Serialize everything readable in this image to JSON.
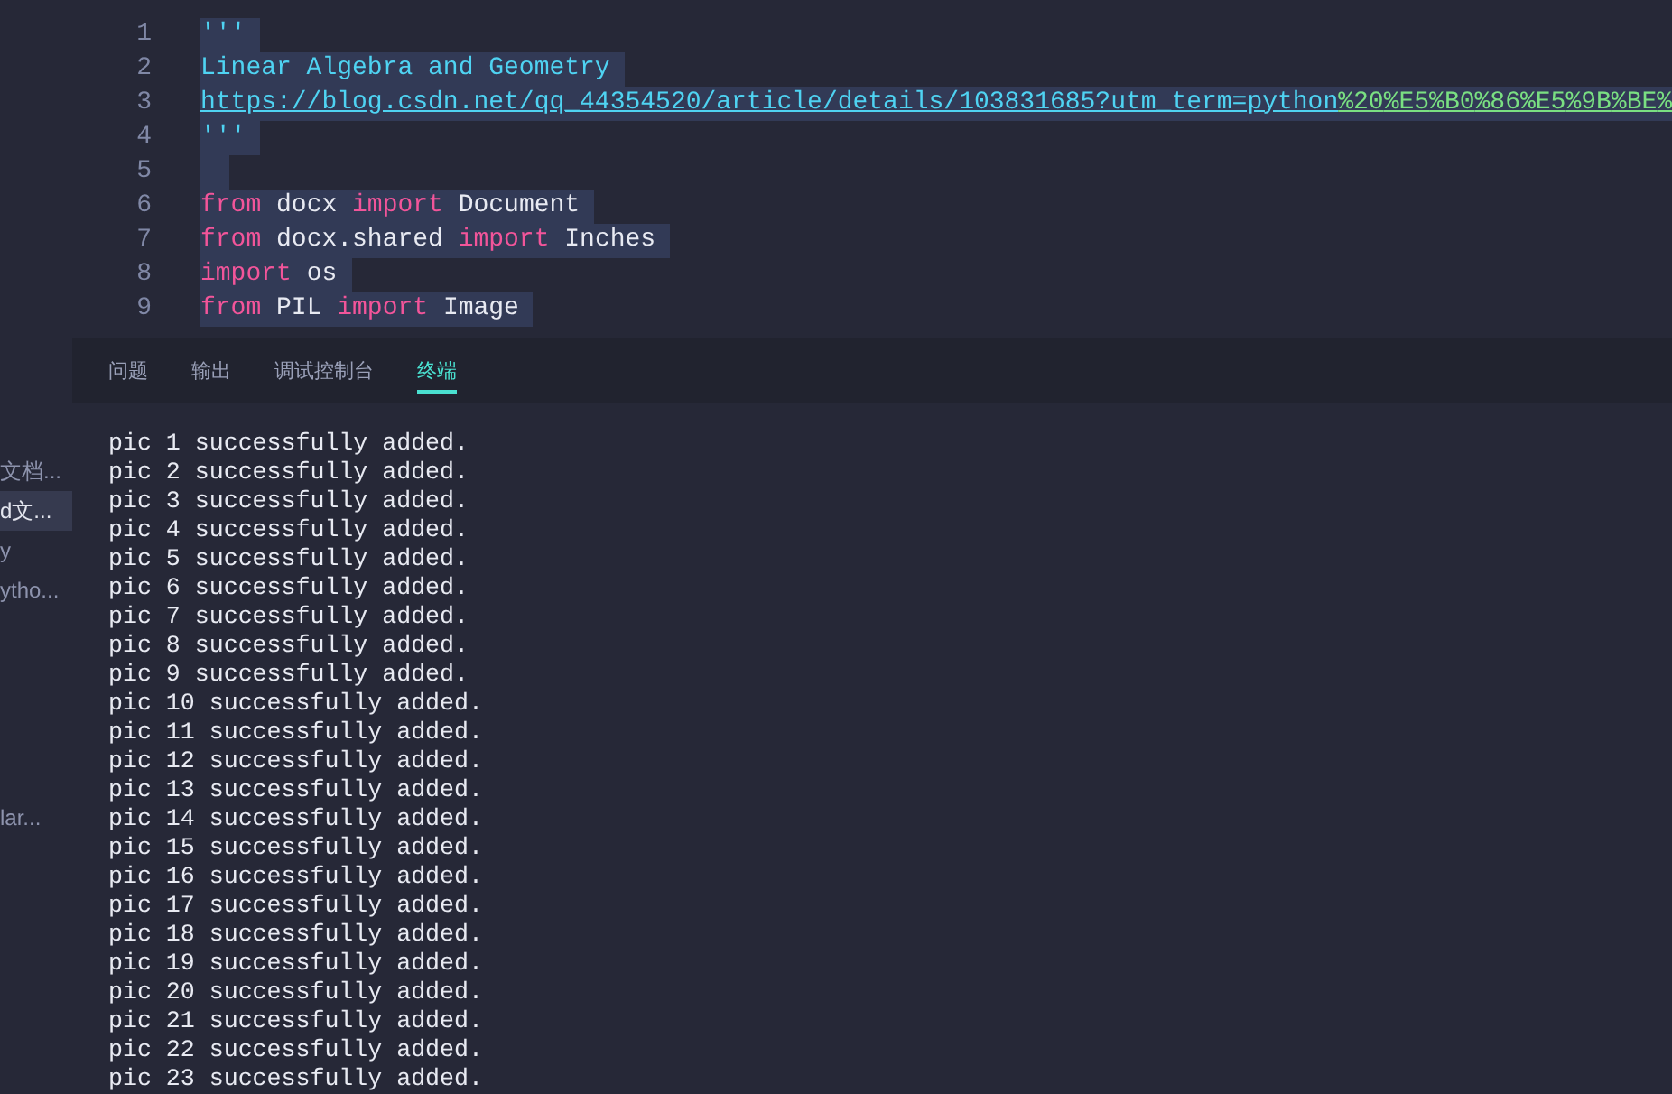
{
  "sidebar": {
    "items": [
      {
        "label": "文档...",
        "selected": false
      },
      {
        "label": "d文...",
        "selected": true
      },
      {
        "label": "y",
        "selected": false
      },
      {
        "label": "ytho...",
        "selected": false
      },
      {
        "label": "lar...",
        "selected": false
      }
    ]
  },
  "editor": {
    "lines": [
      {
        "number": "1",
        "tokens": [
          {
            "kind": "string",
            "text": "'''"
          }
        ]
      },
      {
        "number": "2",
        "tokens": [
          {
            "kind": "string",
            "text": "Linear Algebra and Geometry"
          }
        ]
      },
      {
        "number": "3",
        "tokens": [
          {
            "kind": "link",
            "text": "https://blog.csdn.net/qq_44354520/article/details/103831685?utm_term=python"
          },
          {
            "kind": "escape",
            "text": "%20"
          },
          {
            "kind": "escape",
            "text": "%E5"
          },
          {
            "kind": "escape",
            "text": "%B0"
          },
          {
            "kind": "escape",
            "text": "%86"
          },
          {
            "kind": "escape",
            "text": "%E5"
          },
          {
            "kind": "escape",
            "text": "%9B"
          },
          {
            "kind": "escape",
            "text": "%BE"
          },
          {
            "kind": "escape",
            "text": "%"
          }
        ]
      },
      {
        "number": "4",
        "tokens": [
          {
            "kind": "string",
            "text": "'''"
          }
        ]
      },
      {
        "number": "5"
      },
      {
        "number": "6",
        "tokens": [
          {
            "kind": "keyword",
            "text": "from"
          },
          {
            "kind": "plain",
            "text": " docx "
          },
          {
            "kind": "keyword",
            "text": "import"
          },
          {
            "kind": "plain",
            "text": " Document"
          }
        ]
      },
      {
        "number": "7",
        "tokens": [
          {
            "kind": "keyword",
            "text": "from"
          },
          {
            "kind": "plain",
            "text": " docx.shared "
          },
          {
            "kind": "keyword",
            "text": "import"
          },
          {
            "kind": "plain",
            "text": " Inches"
          }
        ]
      },
      {
        "number": "8",
        "tokens": [
          {
            "kind": "keyword",
            "text": "import"
          },
          {
            "kind": "plain",
            "text": " os"
          }
        ]
      },
      {
        "number": "9",
        "tokens": [
          {
            "kind": "keyword",
            "text": "from"
          },
          {
            "kind": "plain",
            "text": " PIL "
          },
          {
            "kind": "keyword",
            "text": "import"
          },
          {
            "kind": "plain",
            "text": " Image"
          }
        ]
      }
    ]
  },
  "panel": {
    "tabs": [
      {
        "label": "问题",
        "selected": false
      },
      {
        "label": "输出",
        "selected": false
      },
      {
        "label": "调试控制台",
        "selected": false
      },
      {
        "label": "终端",
        "selected": true
      }
    ],
    "terminal_lines": [
      "pic 1 successfully added.",
      "pic 2 successfully added.",
      "pic 3 successfully added.",
      "pic 4 successfully added.",
      "pic 5 successfully added.",
      "pic 6 successfully added.",
      "pic 7 successfully added.",
      "pic 8 successfully added.",
      "pic 9 successfully added.",
      "pic 10 successfully added.",
      "pic 11 successfully added.",
      "pic 12 successfully added.",
      "pic 13 successfully added.",
      "pic 14 successfully added.",
      "pic 15 successfully added.",
      "pic 16 successfully added.",
      "pic 17 successfully added.",
      "pic 18 successfully added.",
      "pic 19 successfully added.",
      "pic 20 successfully added.",
      "pic 21 successfully added.",
      "pic 22 successfully added.",
      "pic 23 successfully added."
    ]
  }
}
